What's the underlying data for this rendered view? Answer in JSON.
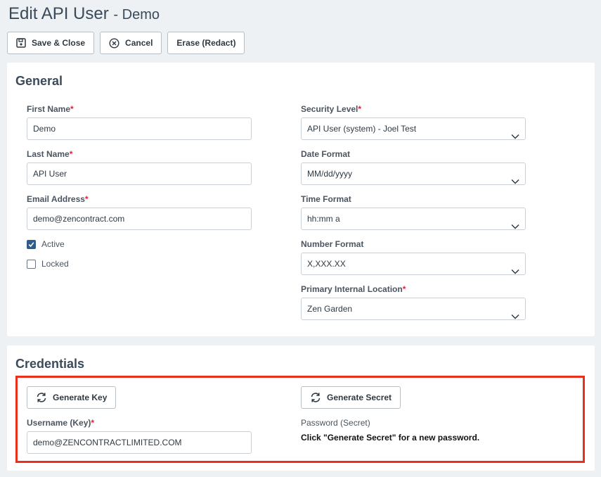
{
  "page": {
    "title": "Edit API User",
    "subtitle": "- Demo"
  },
  "toolbar": {
    "save_close": "Save & Close",
    "cancel": "Cancel",
    "erase": "Erase (Redact)"
  },
  "general": {
    "heading": "General",
    "first_name": {
      "label": "First Name",
      "value": "Demo"
    },
    "last_name": {
      "label": "Last Name",
      "value": "API User"
    },
    "email": {
      "label": "Email Address",
      "value": "demo@zencontract.com"
    },
    "active": {
      "label": "Active",
      "checked": true
    },
    "locked": {
      "label": "Locked",
      "checked": false
    },
    "security_level": {
      "label": "Security Level",
      "value": "API User (system) - Joel Test"
    },
    "date_format": {
      "label": "Date Format",
      "value": "MM/dd/yyyy"
    },
    "time_format": {
      "label": "Time Format",
      "value": "hh:mm a"
    },
    "number_format": {
      "label": "Number Format",
      "value": "X,XXX.XX"
    },
    "primary_location": {
      "label": "Primary Internal Location",
      "value": "Zen Garden"
    }
  },
  "credentials": {
    "heading": "Credentials",
    "generate_key": "Generate Key",
    "generate_secret": "Generate Secret",
    "username": {
      "label": "Username (Key)",
      "value": "demo@ZENCONTRACTLIMITED.COM"
    },
    "password": {
      "label": "Password (Secret)",
      "note": "Click \"Generate Secret\" for a new password."
    }
  },
  "colors": {
    "required": "#d7263d",
    "highlight": "#e8301c",
    "checkbox": "#2f5c8a"
  },
  "icons": {
    "save": "floppy-disk-icon",
    "cancel": "circle-x-icon",
    "refresh": "refresh-icon",
    "chevron": "chevron-down-icon"
  }
}
